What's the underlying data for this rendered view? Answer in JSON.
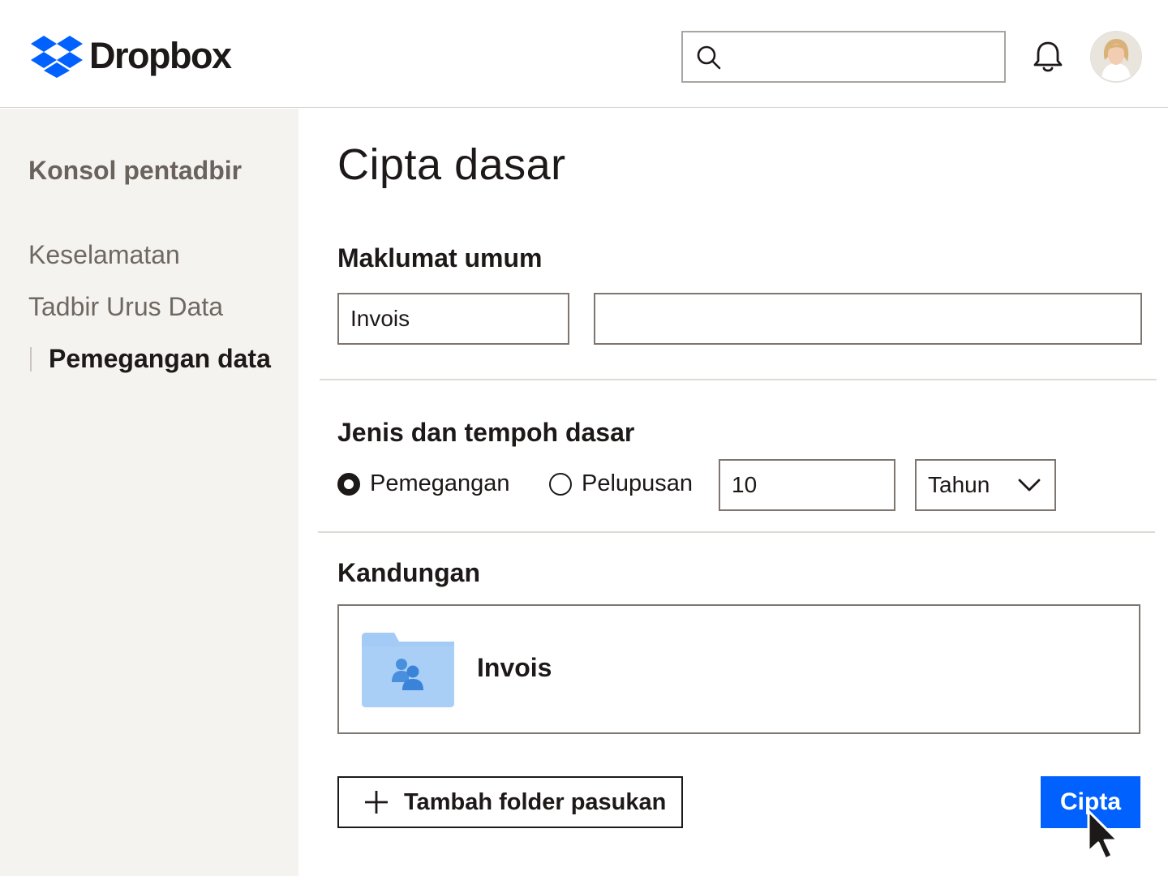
{
  "header": {
    "brand": "Dropbox",
    "brand_color": "#0061fe",
    "search": {
      "value": "",
      "placeholder": ""
    },
    "icons": {
      "search": "search-icon",
      "bell": "bell-icon",
      "avatar": "user-avatar"
    }
  },
  "sidebar": {
    "title": "Konsol pentadbir",
    "items": [
      {
        "label": "Keselamatan",
        "active": false
      },
      {
        "label": "Tadbir Urus Data",
        "active": false
      },
      {
        "label": "Pemegangan data",
        "active": true
      }
    ]
  },
  "main": {
    "title": "Cipta dasar",
    "general": {
      "heading": "Maklumat umum",
      "name_value": "Invois",
      "description_value": ""
    },
    "type_period": {
      "heading": "Jenis dan tempoh dasar",
      "options": [
        {
          "label": "Pemegangan",
          "checked": true
        },
        {
          "label": "Pelupusan",
          "checked": false
        }
      ],
      "duration_value": "10",
      "unit_selected": "Tahun"
    },
    "content": {
      "heading": "Kandungan",
      "folder_name": "Invois",
      "folder_icon": "team-folder-icon"
    },
    "actions": {
      "add_label": "Tambah folder pasukan",
      "create_label": "Cipta"
    }
  }
}
